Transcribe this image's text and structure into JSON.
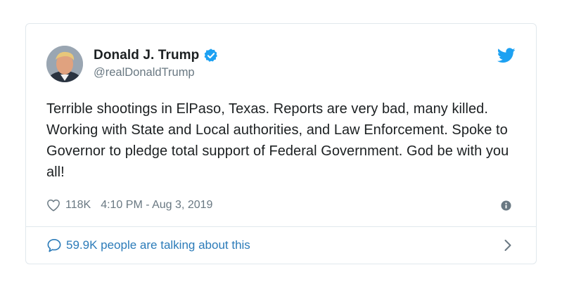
{
  "author": {
    "display_name": "Donald J. Trump",
    "handle": "@realDonaldTrump",
    "verified": true,
    "avatar_icon": "profile-photo"
  },
  "tweet": {
    "text": "Terrible shootings in ElPaso, Texas. Reports are very bad, many killed. Working with State and Local authorities, and Law Enforcement. Spoke to Governor to pledge total support of Federal Government. God be with you all!"
  },
  "meta": {
    "likes": "118K",
    "timestamp": "4:10 PM - Aug 3, 2019"
  },
  "footer": {
    "conversation_label": "59.9K people are talking about this"
  },
  "colors": {
    "twitter_blue": "#1da1f2",
    "link_blue": "#2b7bb9",
    "muted_gray": "#697882",
    "border": "#e1e8ed"
  },
  "icons": [
    "verified-badge-icon",
    "twitter-bird-icon",
    "heart-icon",
    "info-icon",
    "speech-bubble-icon",
    "chevron-right-icon"
  ]
}
